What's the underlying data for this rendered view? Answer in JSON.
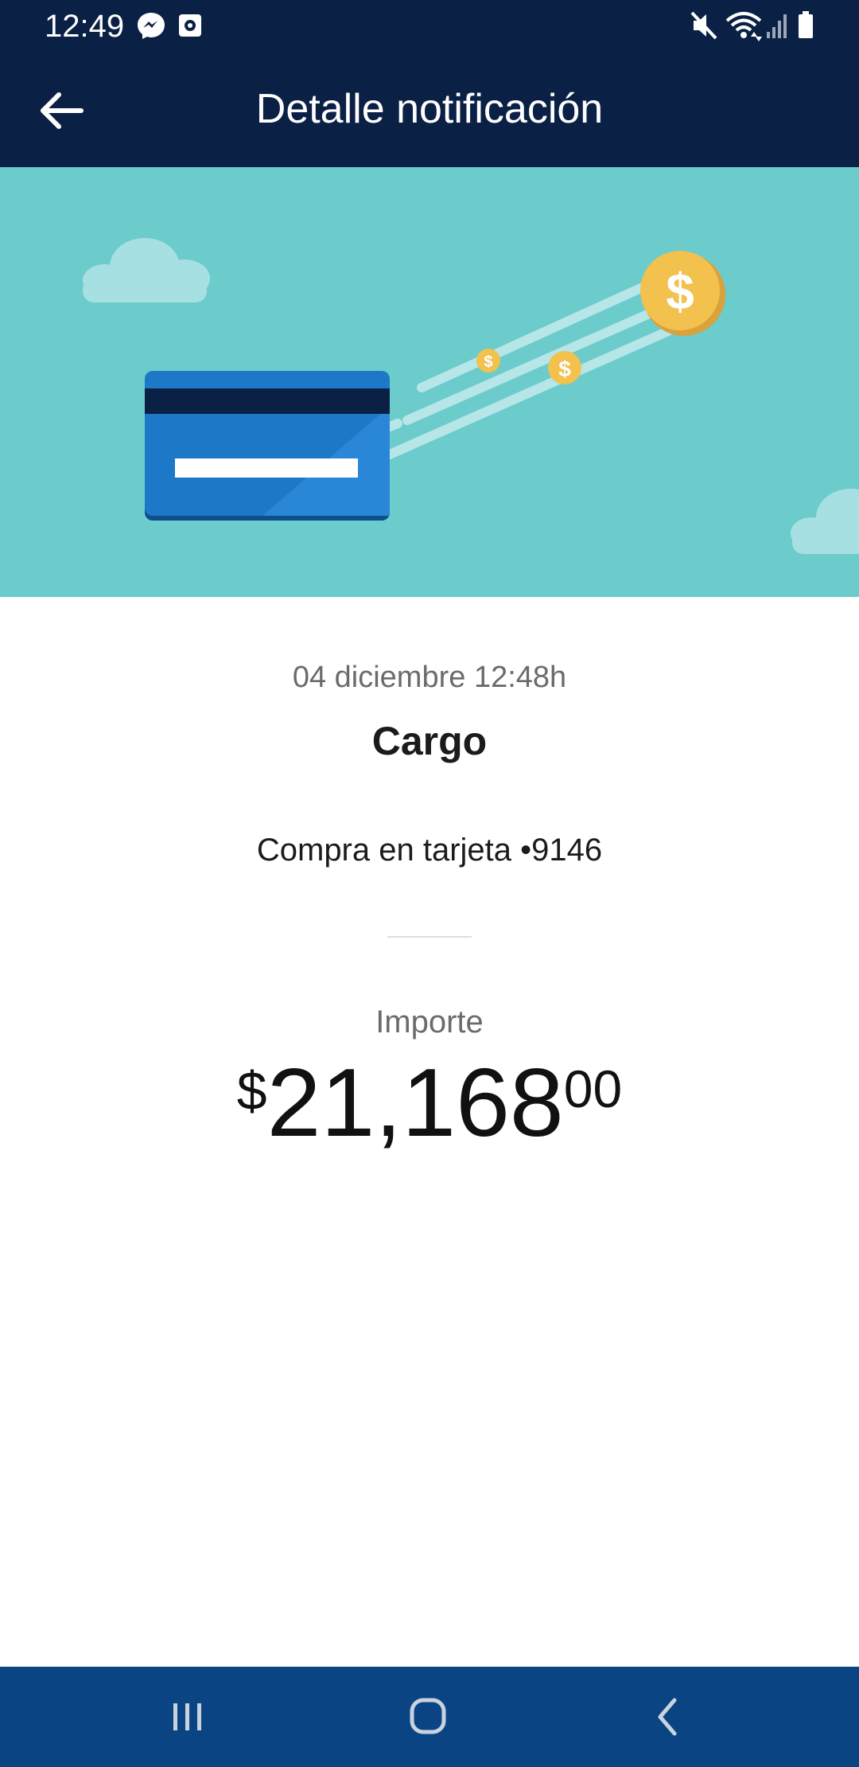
{
  "status_bar": {
    "time": "12:49",
    "left_icons": [
      "messenger-icon",
      "screen-record-icon"
    ],
    "right_icons": [
      "mute-icon",
      "wifi-icon",
      "signal-icon",
      "battery-icon"
    ]
  },
  "app_bar": {
    "title": "Detalle notificación",
    "back_icon": "arrow-left-icon"
  },
  "notification": {
    "datetime": "04 diciembre 12:48h",
    "type": "Cargo",
    "description": "Compra en tarjeta •9146",
    "amount_label": "Importe",
    "amount": {
      "currency": "$",
      "integer": "21,168",
      "decimals": "00"
    }
  },
  "colors": {
    "header_bg": "#0b2045",
    "hero_bg": "#6ccbcb",
    "card_blue": "#1e78c8",
    "coin_gold": "#f2c14e",
    "nav_bg": "#0b4482"
  },
  "nav_bar": {
    "icons": [
      "recent-apps-icon",
      "home-icon",
      "back-icon"
    ]
  }
}
